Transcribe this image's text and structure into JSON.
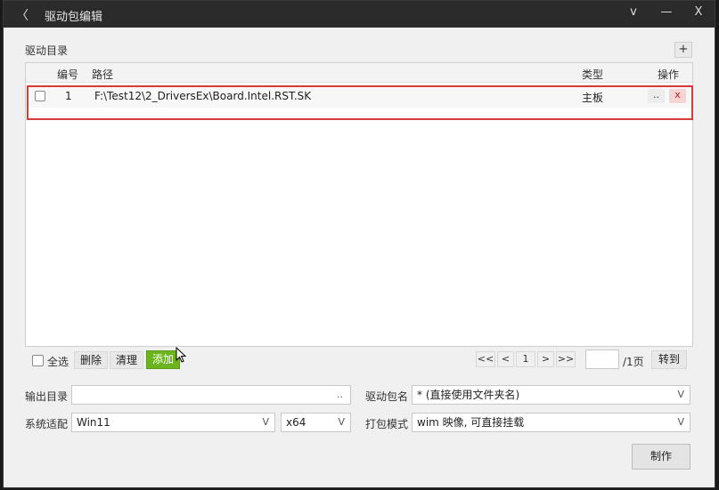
{
  "window": {
    "back": "〈",
    "title": "驱动包编辑",
    "chevron": "v",
    "minimize": "—",
    "close": "X"
  },
  "section_label": "驱动目录",
  "add_row_button": "+",
  "table": {
    "columns": [
      "编号",
      "路径",
      "类型",
      "操作"
    ],
    "rows": [
      {
        "index": "1",
        "path": "F:\\Test12\\2_DriversEx\\Board.Intel.RST.SK",
        "type": "主板",
        "browse": "..",
        "remove": "x"
      }
    ]
  },
  "actions": {
    "select_all": "全选",
    "delete": "删除",
    "clear": "清理",
    "add": "添加"
  },
  "pager": {
    "first": "<<",
    "prev": "<",
    "current": "1",
    "next": ">",
    "last": ">>",
    "page_input": "",
    "total": "/1页",
    "goto": "转到"
  },
  "form": {
    "output_dir_label": "输出目录",
    "output_dir_value": "",
    "output_dir_browse": "..",
    "package_name_label": "驱动包名",
    "package_name_value": "* (直接使用文件夹名)",
    "os_label": "系统适配",
    "os_value": "Win11",
    "arch_value": "x64",
    "pack_mode_label": "打包模式",
    "pack_mode_value": "wim 映像, 可直接挂载",
    "dropdown_arrow": "V"
  },
  "make_button": "制作",
  "colors": {
    "titlebar": "#2b2b2b",
    "add_button": "#6bb31f",
    "remove_button": "#f6d4d4",
    "highlight_box": "#d93a3a"
  }
}
